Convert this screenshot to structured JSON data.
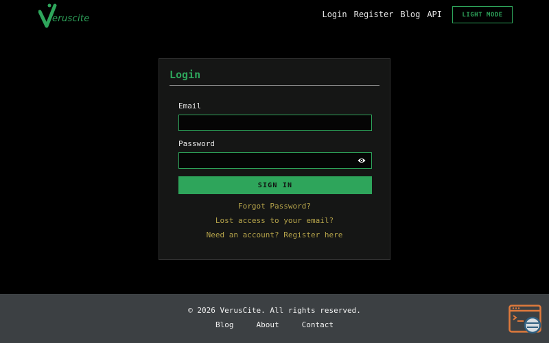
{
  "header": {
    "logo_text": "eruscite",
    "nav": [
      "Login",
      "Register",
      "Blog",
      "API"
    ],
    "mode_button": "LIGHT MODE"
  },
  "login": {
    "title": "Login",
    "email_label": "Email",
    "email_value": "",
    "password_label": "Password",
    "password_value": "",
    "submit": "SIGN IN",
    "links": [
      "Forgot Password?",
      "Lost access to your email?",
      "Need an account? Register here"
    ]
  },
  "footer": {
    "copyright": "© 2026 VerusCite. All rights reserved.",
    "links": [
      "Blog",
      "About",
      "Contact"
    ]
  },
  "colors": {
    "accent": "#2ea55b",
    "link": "#b5a34a",
    "footer_bg": "#3c4043",
    "card_bg": "#151615"
  },
  "icons": [
    "verus-logo-v",
    "eye-icon",
    "help-widget-icon"
  ]
}
